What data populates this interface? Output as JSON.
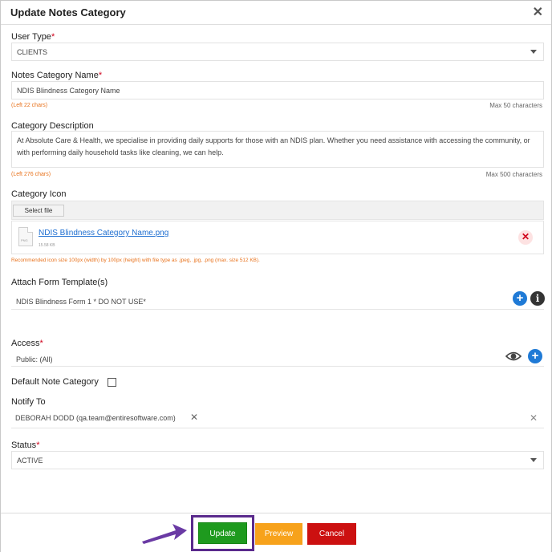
{
  "dialog": {
    "title": "Update Notes Category",
    "close_icon": "close-icon"
  },
  "user_type": {
    "label": "User Type",
    "required": "*",
    "value": "CLIENTS"
  },
  "notes_category_name": {
    "label": "Notes Category Name",
    "required": "*",
    "value": "NDIS Blindness Category Name",
    "left_chars": "(Left 22 chars)",
    "max_chars": "Max 50 characters"
  },
  "category_description": {
    "label": "Category Description",
    "value": "At Absolute Care & Health, we specialise in providing daily supports for those with an NDIS plan. Whether you need assistance with accessing the community, or with performing daily household tasks like cleaning, we can help.",
    "left_chars": "(Left 276 chars)",
    "max_chars": "Max 500 characters"
  },
  "category_icon": {
    "label": "Category Icon",
    "select_button": "Select file",
    "file_name": "NDIS Blindness Category Name.png",
    "file_size": "15.58 KB",
    "file_type": "PNG",
    "hint": "Recommended icon size 100px (width) by 100px (height) with file type as .jpeg, .jpg, .png (max. size 512 KB)."
  },
  "attach_form": {
    "label": "Attach Form Template(s)",
    "value": "NDIS Blindness Form 1 * DO NOT USE*",
    "icons": [
      "plus-icon",
      "info-icon"
    ]
  },
  "access": {
    "label": "Access",
    "required": "*",
    "value": "Public: (All)",
    "icons": [
      "eye-icon",
      "plus-icon"
    ]
  },
  "default_note_category": {
    "label": "Default Note Category",
    "checked": false
  },
  "notify_to": {
    "label": "Notify To",
    "tags": [
      "DEBORAH DODD (qa.team@entiresoftware.com)"
    ]
  },
  "status": {
    "label": "Status",
    "required": "*",
    "value": "ACTIVE"
  },
  "footer": {
    "update": "Update",
    "preview": "Preview",
    "cancel": "Cancel"
  },
  "colors": {
    "update": "#1e9a1e",
    "preview": "#f7a21b",
    "cancel": "#cc1010",
    "highlight": "#5a2a8c",
    "accent": "#1f7ad6",
    "hint": "#e8721c"
  }
}
